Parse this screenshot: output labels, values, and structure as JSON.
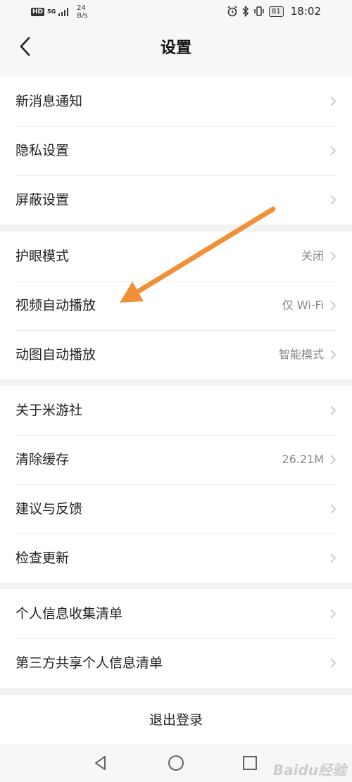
{
  "status_bar": {
    "hd": "HD",
    "network": "5G",
    "speed_value": "24",
    "speed_unit": "B/s",
    "battery": "81",
    "time": "18:02"
  },
  "header": {
    "title": "设置",
    "back_icon": "chevron-left-icon"
  },
  "groups": [
    {
      "items": [
        {
          "label": "新消息通知",
          "value": ""
        },
        {
          "label": "隐私设置",
          "value": ""
        },
        {
          "label": "屏蔽设置",
          "value": ""
        }
      ]
    },
    {
      "items": [
        {
          "label": "护眼模式",
          "value": "关闭"
        },
        {
          "label": "视频自动播放",
          "value": "仅 Wi-Fi"
        },
        {
          "label": "动图自动播放",
          "value": "智能模式"
        }
      ]
    },
    {
      "items": [
        {
          "label": "关于米游社",
          "value": ""
        },
        {
          "label": "清除缓存",
          "value": "26.21M"
        },
        {
          "label": "建议与反馈",
          "value": ""
        },
        {
          "label": "检查更新",
          "value": ""
        }
      ]
    },
    {
      "items": [
        {
          "label": "个人信息收集清单",
          "value": ""
        },
        {
          "label": "第三方共享个人信息清单",
          "value": ""
        }
      ]
    }
  ],
  "logout_label": "退出登录",
  "watermark": "Baidu经验",
  "colors": {
    "background": "#f2f2f2",
    "row_bg": "#ffffff",
    "text": "#222222",
    "secondary_text": "#888888",
    "chevron": "#c4c4c4",
    "annotation_arrow": "#f0913a"
  }
}
